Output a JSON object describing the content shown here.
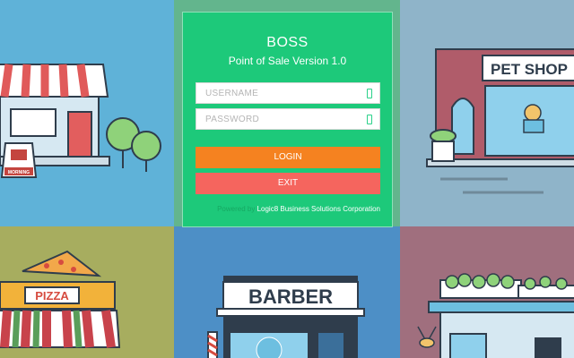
{
  "app": {
    "title": "BOSS",
    "subtitle": "Point of Sale Version 1.0"
  },
  "form": {
    "username_placeholder": "USERNAME",
    "password_placeholder": "PASSWORD",
    "login_label": "LOGIN",
    "exit_label": "EXIT"
  },
  "footer": {
    "powered_by": "Powered by",
    "company": "Logic8 Business Solutions Corporation"
  },
  "illustrations": {
    "morning_sign": "MORNING",
    "pet_shop_sign": "PET SHOP",
    "pizza_sign": "PIZZA",
    "barber_sign": "BARBER"
  },
  "colors": {
    "card": "#1dc97a",
    "login_button": "#f58220",
    "exit_button": "#f5655e"
  }
}
